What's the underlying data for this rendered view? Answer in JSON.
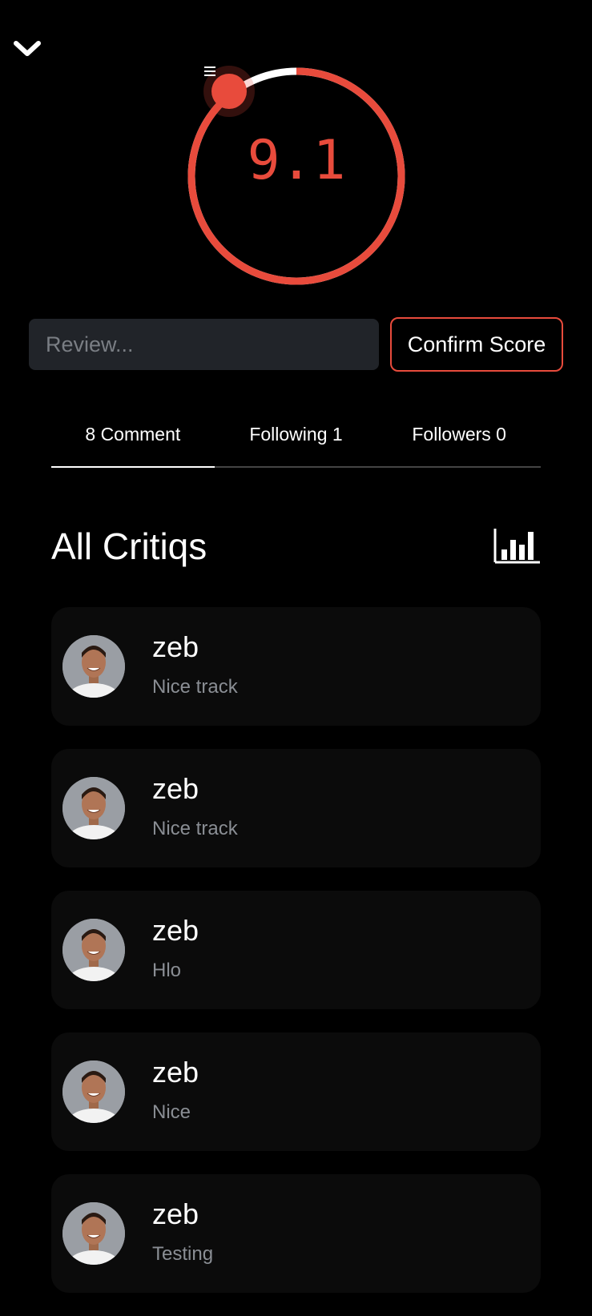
{
  "colors": {
    "accent": "#e84b3c",
    "background": "#000000",
    "input_bg": "#212429",
    "card_bg": "#0b0b0b",
    "muted_text": "#8a8e94"
  },
  "header": {
    "collapse_icon": "chevron-down-icon"
  },
  "score": {
    "value": "9.1",
    "max": 10,
    "handle_icon": "menu-lines-icon"
  },
  "review": {
    "placeholder": "Review...",
    "confirm_label": "Confirm Score"
  },
  "tabs": [
    {
      "label": "8 Comment",
      "active": true
    },
    {
      "label": "Following 1",
      "active": false
    },
    {
      "label": "Followers 0",
      "active": false
    }
  ],
  "section": {
    "title": "All Critiqs",
    "stats_icon": "bar-chart-icon"
  },
  "comments": [
    {
      "user": "zeb",
      "text": "Nice track"
    },
    {
      "user": "zeb",
      "text": "Nice track"
    },
    {
      "user": "zeb",
      "text": "Hlo"
    },
    {
      "user": "zeb",
      "text": "Nice"
    },
    {
      "user": "zeb",
      "text": "Testing"
    }
  ]
}
